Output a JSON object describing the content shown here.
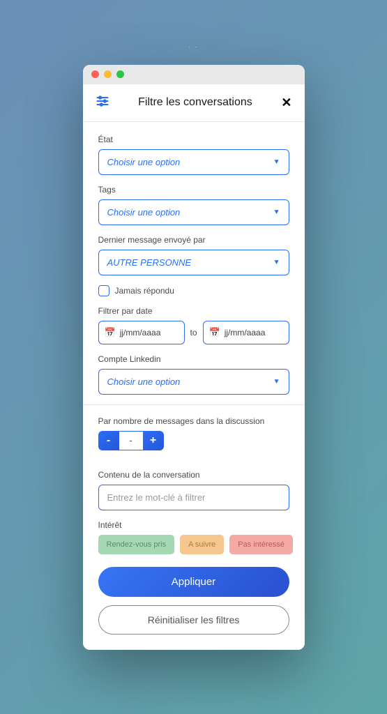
{
  "header": {
    "title": "Filtre les conversations"
  },
  "filters": {
    "etat": {
      "label": "État",
      "placeholder": "Choisir une option"
    },
    "tags": {
      "label": "Tags",
      "placeholder": "Choisir une option"
    },
    "dernier_message": {
      "label": "Dernier message envoyé par",
      "value": "AUTRE PERSONNE"
    },
    "jamais_repondu": {
      "label": "Jamais répondu"
    },
    "par_date": {
      "label": "Filtrer par date",
      "from_placeholder": "jj/mm/aaaa",
      "sep": "to",
      "to_placeholder": "jj/mm/aaaa"
    },
    "compte_linkedin": {
      "label": "Compte Linkedin",
      "placeholder": "Choisir une option"
    },
    "nb_messages": {
      "label": "Par nombre de messages dans la discussion",
      "value": "-"
    },
    "contenu": {
      "label": "Contenu de la conversation",
      "placeholder": "Entrez le mot-clé à filtrer"
    },
    "interet": {
      "label": "Intérêt",
      "options": [
        "Rendez-vous pris",
        "A suivre",
        "Pas intéressé"
      ]
    }
  },
  "buttons": {
    "apply": "Appliquer",
    "reset": "Réinitialiser les filtres"
  }
}
